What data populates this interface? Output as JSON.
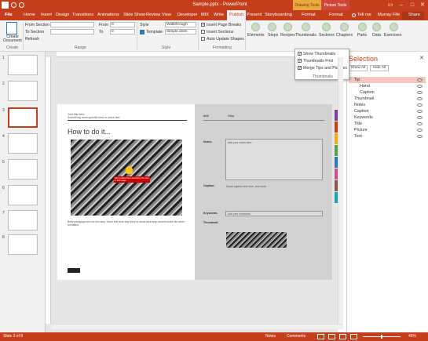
{
  "window": {
    "title": "Sample.pptx - PowerPoint",
    "context_tab_drawing": "Drawing Tools",
    "context_tab_picture": "Picture Tools",
    "tell_me": "Tell me",
    "user": "Murray Fife",
    "share": "Share"
  },
  "tabs": [
    "File",
    "Home",
    "Insert",
    "Design",
    "Transitions",
    "Animations",
    "Slide Show",
    "Review",
    "View",
    "Developer",
    "MIX",
    "Write",
    "Publish",
    "Present",
    "Storyboarding",
    "Format",
    "Format"
  ],
  "ribbon": {
    "create_label": "Create\nDocument",
    "group_create": "Create",
    "from_section": "From Section",
    "to_section": "To Section",
    "refresh": "Refresh",
    "from_label": "From",
    "to_label": "To",
    "from_value": "0",
    "to_value": "0",
    "group_range": "Range",
    "style_label": "Style",
    "style_value": "Walkthrough",
    "template_label": "Template",
    "template_value": "Simple.dotm",
    "group_style": "Style",
    "insert_page_breaks": "Insert Page Breaks",
    "insert_sections": "Insert Sections",
    "auto_update_shapes": "Auto Update Shapes",
    "group_formatting": "Formatting",
    "buttons": [
      "Elements",
      "Steps",
      "Recipes",
      "Thumbnails",
      "Sections",
      "Chapters",
      "Parts",
      "Data",
      "Exercises"
    ]
  },
  "dropdown": {
    "items": [
      "Show Thumbnails",
      "Thumbnails First",
      "Merge Tips and Pictures"
    ],
    "group": "Thumbnails"
  },
  "slides": [
    "1",
    "2",
    "3",
    "4",
    "5",
    "6",
    "7",
    "8"
  ],
  "slide_left": {
    "header1": "Your title here",
    "header2": "Something more specific here or some text",
    "heading": "How to do it...",
    "callout": "Add a callout here describing the step in this image.",
    "body": "Body paragraph text for this step. Some text here and there to show what step content looks like when formatted."
  },
  "slide_right": {
    "col1": "###",
    "col2": "Step",
    "notes_label": "Notes:",
    "notes_placeholder": "Add your notes here",
    "caption_label": "Caption:",
    "caption_text": "Some caption text here, and more",
    "keywords_label": "Keywords:",
    "keywords_placeholder": "Add your keywords",
    "thumbnail_label": "Thumbnail:"
  },
  "selection": {
    "title": "Selection",
    "show_all": "Show All",
    "hide_all": "Hide All",
    "items": [
      {
        "label": "Tip",
        "indent": 0,
        "selected": true
      },
      {
        "label": "Hand",
        "indent": 2,
        "selected": false
      },
      {
        "label": "Caption",
        "indent": 1,
        "selected": false
      },
      {
        "label": "Thumbnail",
        "indent": 0,
        "selected": false
      },
      {
        "label": "Notes",
        "indent": 0,
        "selected": false
      },
      {
        "label": "Caption",
        "indent": 0,
        "selected": false
      },
      {
        "label": "Keywords",
        "indent": 0,
        "selected": false
      },
      {
        "label": "Title",
        "indent": 0,
        "selected": false
      },
      {
        "label": "Picture",
        "indent": 0,
        "selected": false
      },
      {
        "label": "Text",
        "indent": 0,
        "selected": false
      }
    ]
  },
  "status": {
    "slide": "Slide 3 of 8",
    "notes": "Notes",
    "comments": "Comments",
    "zoom": "46%"
  },
  "colors": {
    "accent": "#c43e1c",
    "strip": [
      "#7b3fa0",
      "#c43e1c",
      "#e8b020",
      "#59a14f",
      "#2b7bba",
      "#d04a8e",
      "#8c564b",
      "#17a2b8"
    ]
  }
}
